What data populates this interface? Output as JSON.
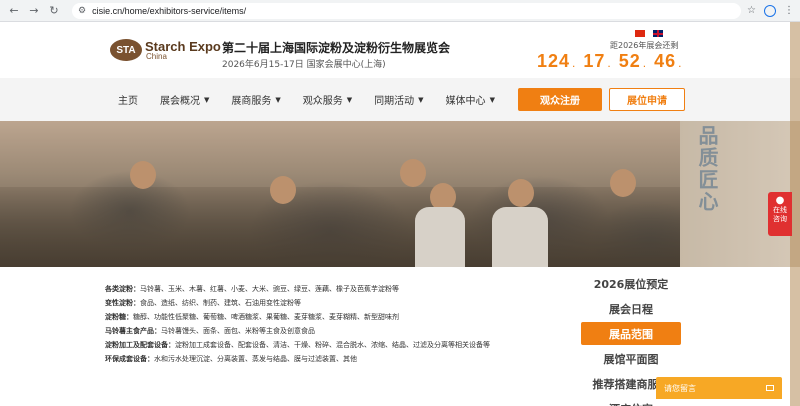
{
  "browser": {
    "url": "cisie.cn/home/exhibitors-service/items/",
    "back_icon": "arrow-left-icon",
    "forward_icon": "arrow-right-icon",
    "reload_icon": "reload-icon"
  },
  "header": {
    "logo_badge": "STA",
    "logo_en": "Starch Expo",
    "logo_sub": "China",
    "title": "第二十届上海国际淀粉及淀粉衍生物展览会",
    "subtitle": "2026年6月15-17日 国家会展中心(上海)",
    "countdown_label": "距2026年展会还剩",
    "countdown": [
      "124",
      "17",
      "52",
      "46"
    ]
  },
  "nav": {
    "items": [
      {
        "label": "主页",
        "dropdown": false
      },
      {
        "label": "展会概况",
        "dropdown": true
      },
      {
        "label": "展商服务",
        "dropdown": true
      },
      {
        "label": "观众服务",
        "dropdown": true
      },
      {
        "label": "同期活动",
        "dropdown": true
      },
      {
        "label": "媒体中心",
        "dropdown": true
      }
    ],
    "register_label": "观众注册",
    "booth_label": "展位申请"
  },
  "banner": {
    "wall_text": "品质匠心"
  },
  "categories": [
    {
      "label": "各类淀粉：",
      "text": "马铃薯、玉米、木薯、红薯、小麦、大米、豌豆、绿豆、莲藕、橡子及芭蕉芋淀粉等"
    },
    {
      "label": "变性淀粉：",
      "text": "食品、造纸、纺织、制药、建筑、石油用变性淀粉等"
    },
    {
      "label": "淀粉糖：",
      "text": "糖醇、功能性低聚糖、葡萄糖、啤酒糖浆、果葡糖、麦芽糖浆、麦芽糊精、新型甜味剂"
    },
    {
      "label": "马铃薯主食产品：",
      "text": "马铃薯馒头、面条、面包、米粉等主食及创意食品"
    },
    {
      "label": "淀粉加工及配套设备：",
      "text": "淀粉加工成套设备、配套设备、清洁、干燥、粉碎、混合脱水、浓缩、结晶、过滤及分离等相关设备等"
    },
    {
      "label": "环保成套设备：",
      "text": "水和污水处理沉淀、分离装置、蒸发与结晶、膜与过滤装置、其他"
    }
  ],
  "side_menu": [
    {
      "label": "2026展位预定",
      "active": false
    },
    {
      "label": "展会日程",
      "active": false
    },
    {
      "label": "展品范围",
      "active": true
    },
    {
      "label": "展馆平面图",
      "active": false
    },
    {
      "label": "推荐搭建商服务",
      "active": false
    },
    {
      "label": "酒店住宿",
      "active": false
    }
  ],
  "float": {
    "chat_line1": "在线",
    "chat_line2": "咨询",
    "message_label": "请您留言"
  },
  "colors": {
    "accent": "#f07f12",
    "logo_brown": "#7a5230",
    "chat_red": "#e03030"
  }
}
